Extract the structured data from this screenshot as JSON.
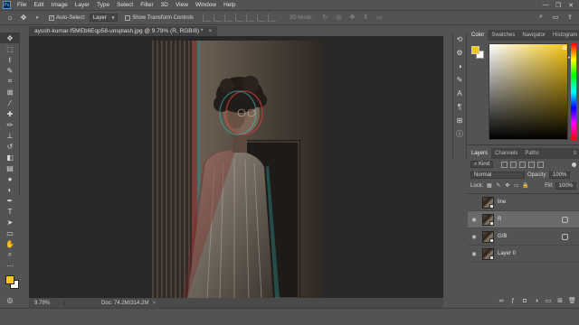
{
  "app": {
    "logo": "Ps",
    "menu": [
      "File",
      "Edit",
      "Image",
      "Layer",
      "Type",
      "Select",
      "Filter",
      "3D",
      "View",
      "Window",
      "Help"
    ],
    "window_controls": [
      "—",
      "❐",
      "✕"
    ]
  },
  "options_bar": {
    "auto_select_label": "Auto-Select:",
    "auto_select_value": "Layer",
    "show_transform_label": "Show Transform Controls",
    "mode_label": "3D Mode:"
  },
  "document": {
    "tab_title": "ayush-kumar-f5MEb6Eqp58-unsplash.jpg @ 9.79% (R, RGB/8) *",
    "tab_close": "×",
    "status_zoom": "9.79%",
    "status_doc": "Doc: 74.2M/314.2M",
    "status_arrow": ">"
  },
  "color_panel": {
    "tabs": [
      "Color",
      "Swatches",
      "Navigator",
      "Histogram"
    ],
    "active_tab": "Color",
    "foreground": "#f7c613",
    "background": "#ffffff"
  },
  "layers_panel": {
    "tabs": [
      "Layers",
      "Channels",
      "Paths"
    ],
    "kind_label": "Kind",
    "blend_mode": "Normal",
    "opacity_label": "Opacity:",
    "opacity_value": "100%",
    "lock_label": "Lock:",
    "fill_label": "Fill:",
    "fill_value": "100%",
    "layers": [
      {
        "name": "line",
        "visible": false,
        "selected": false,
        "fx": false
      },
      {
        "name": "R",
        "visible": true,
        "selected": true,
        "fx": true
      },
      {
        "name": "G/B",
        "visible": true,
        "selected": false,
        "fx": true
      },
      {
        "name": "Layer 0",
        "visible": true,
        "selected": false,
        "fx": false
      }
    ]
  },
  "colors": {
    "accent": "#31a8ff",
    "panel_bg": "#535353",
    "canvas_bg": "#282828"
  }
}
